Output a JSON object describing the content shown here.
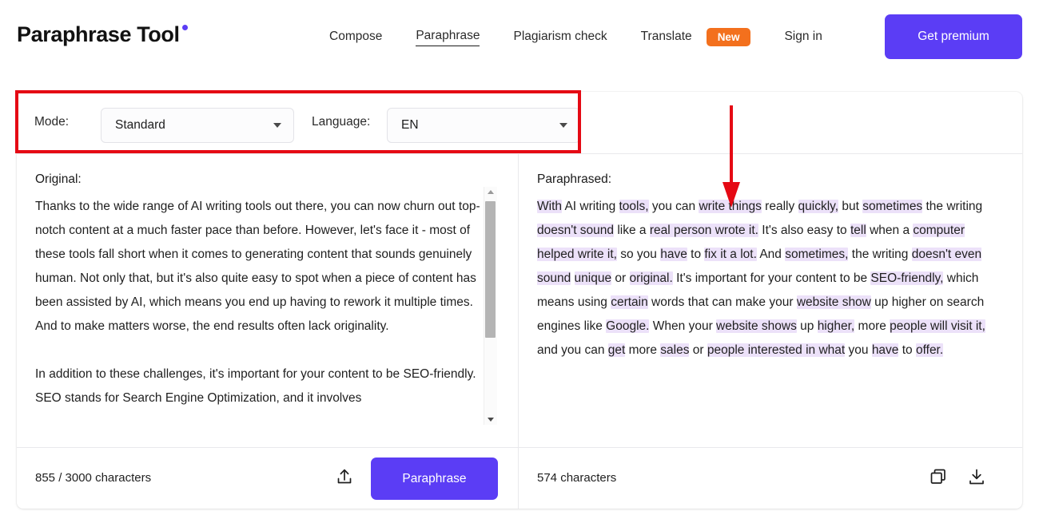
{
  "header": {
    "brand": "Paraphrase Tool",
    "brand_dot_color": "#5b3df5",
    "nav": [
      {
        "label": "Compose",
        "active": false
      },
      {
        "label": "Paraphrase",
        "active": true
      },
      {
        "label": "Plagiarism check",
        "active": false
      },
      {
        "label": "Translate",
        "active": false
      }
    ],
    "translate_badge": "New",
    "badge_color": "#f3701d",
    "sign_in": "Sign in",
    "premium_button": "Get premium",
    "premium_color": "#5b3df5"
  },
  "toolbar": {
    "mode_label": "Mode:",
    "mode_value": "Standard",
    "language_label": "Language:",
    "language_value": "EN"
  },
  "original_panel": {
    "title": "Original:",
    "paragraph_1": "Thanks to the wide range of AI writing tools out there, you can now churn out top-notch content at a much faster pace than before. However, let's face it - most of these tools fall short when it comes to generating content that sounds genuinely human. Not only that, but it's also quite easy to spot when a piece of content has been assisted by AI, which means you end up having to rework it multiple times. And to make matters worse, the end results often lack originality.",
    "paragraph_2": "In addition to these challenges, it's important for your content to be SEO-friendly. SEO stands for Search Engine Optimization, and it involves",
    "char_count": "855 / 3000 characters",
    "paraphrase_button": "Paraphrase",
    "upload_icon": "upload-icon"
  },
  "paraphrased_panel": {
    "title": "Paraphrased:",
    "char_count": "574 characters",
    "copy_icon": "copy-icon",
    "download_icon": "download-icon",
    "highlight_color": "#ece1f9",
    "segments": [
      {
        "text": "With",
        "hl": true
      },
      {
        "text": " AI writing ",
        "hl": false
      },
      {
        "text": "tools,",
        "hl": true
      },
      {
        "text": " you can ",
        "hl": false
      },
      {
        "text": "write things",
        "hl": true
      },
      {
        "text": " really ",
        "hl": false
      },
      {
        "text": "quickly,",
        "hl": true
      },
      {
        "text": " but ",
        "hl": false
      },
      {
        "text": "sometimes",
        "hl": true
      },
      {
        "text": " the writing ",
        "hl": false
      },
      {
        "text": "doesn't sound",
        "hl": true
      },
      {
        "text": " like a ",
        "hl": false
      },
      {
        "text": "real person wrote it.",
        "hl": true
      },
      {
        "text": " It's also easy to ",
        "hl": false
      },
      {
        "text": "tell",
        "hl": true
      },
      {
        "text": " when a ",
        "hl": false
      },
      {
        "text": "computer helped write it,",
        "hl": true
      },
      {
        "text": " so you ",
        "hl": false
      },
      {
        "text": "have",
        "hl": true
      },
      {
        "text": " to ",
        "hl": false
      },
      {
        "text": "fix it a lot.",
        "hl": true
      },
      {
        "text": " And ",
        "hl": false
      },
      {
        "text": "sometimes,",
        "hl": true
      },
      {
        "text": " the writing ",
        "hl": false
      },
      {
        "text": "doesn't even sound",
        "hl": true
      },
      {
        "text": " ",
        "hl": false
      },
      {
        "text": "unique",
        "hl": true
      },
      {
        "text": " or ",
        "hl": false
      },
      {
        "text": "original.",
        "hl": true
      },
      {
        "text": " It's important for your content to be ",
        "hl": false
      },
      {
        "text": "SEO-friendly,",
        "hl": true
      },
      {
        "text": " which means using ",
        "hl": false
      },
      {
        "text": "certain",
        "hl": true
      },
      {
        "text": " words that can make your ",
        "hl": false
      },
      {
        "text": "website show",
        "hl": true
      },
      {
        "text": " up higher on search engines like ",
        "hl": false
      },
      {
        "text": "Google.",
        "hl": true
      },
      {
        "text": " When your ",
        "hl": false
      },
      {
        "text": "website shows",
        "hl": true
      },
      {
        "text": " up ",
        "hl": false
      },
      {
        "text": "higher,",
        "hl": true
      },
      {
        "text": " more ",
        "hl": false
      },
      {
        "text": "people will visit it,",
        "hl": true
      },
      {
        "text": " and you can ",
        "hl": false
      },
      {
        "text": "get",
        "hl": true
      },
      {
        "text": " more ",
        "hl": false
      },
      {
        "text": "sales",
        "hl": true
      },
      {
        "text": " or ",
        "hl": false
      },
      {
        "text": "people interested in what",
        "hl": true
      },
      {
        "text": " you ",
        "hl": false
      },
      {
        "text": "have",
        "hl": true
      },
      {
        "text": " to ",
        "hl": false
      },
      {
        "text": "offer.",
        "hl": true
      }
    ]
  },
  "annotations": {
    "box_color": "#e50914",
    "arrow_color": "#e50914"
  }
}
